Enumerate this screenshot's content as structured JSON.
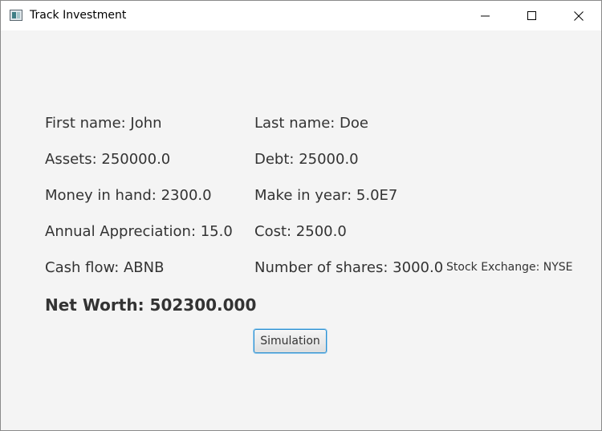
{
  "window": {
    "title": "Track Investment"
  },
  "labels": {
    "first_name": "First name: John",
    "last_name": "Last name: Doe",
    "assets": "Assets: 250000.0",
    "debt": "Debt: 25000.0",
    "money_in_hand": "Money in hand: 2300.0",
    "make_in_year": "Make in year: 5.0E7",
    "annual_appreciation": "Annual Appreciation: 15.0",
    "cost": "Cost: 2500.0",
    "cash_flow": "Cash flow: ABNB",
    "number_of_shares": "Number of shares: 3000.0",
    "stock_exchange": "Stock Exchange: NYSE",
    "net_worth": "Net Worth: 502300.000"
  },
  "buttons": {
    "simulation": "Simulation"
  },
  "colors": {
    "background": "#f4f4f4",
    "text": "#333333",
    "button_focus_border": "#2a8fd1"
  }
}
